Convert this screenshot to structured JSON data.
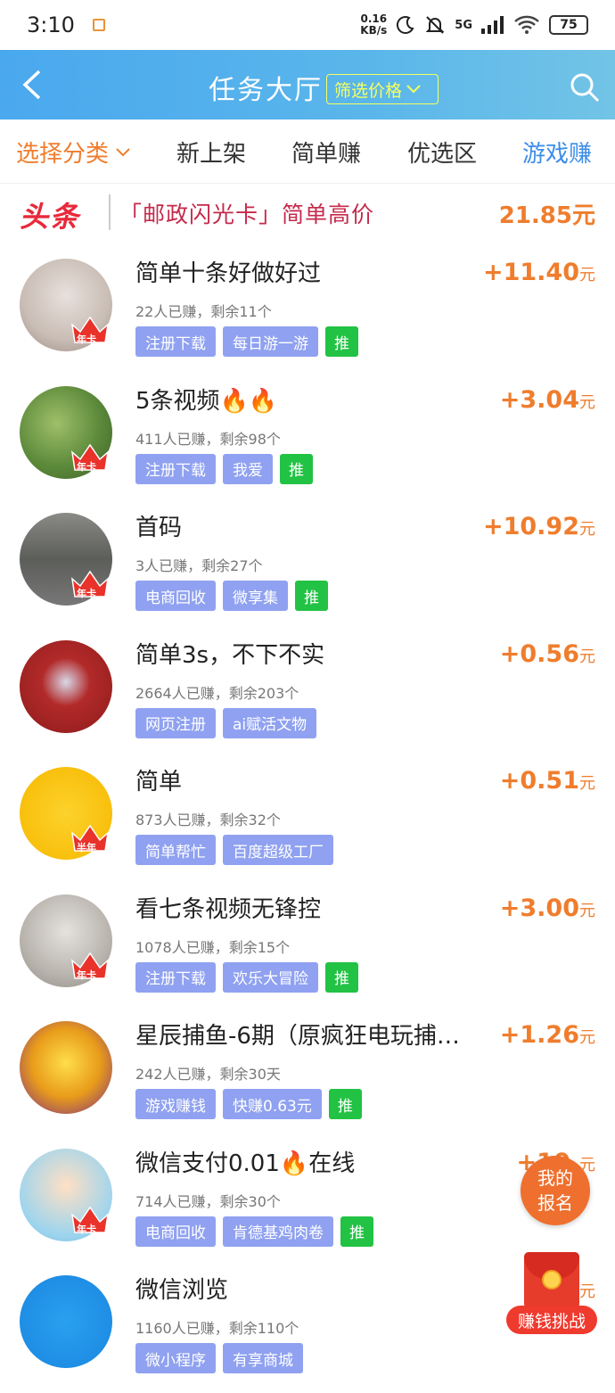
{
  "status_bar": {
    "time": "3:10",
    "speed_value": "0.16",
    "speed_unit": "KB/s",
    "network": "5G",
    "battery": "75"
  },
  "header": {
    "title": "任务大厅",
    "filter_label": "筛选价格"
  },
  "tabs": {
    "category": "选择分类",
    "new": "新上架",
    "simple": "简单赚",
    "preferred": "优选区",
    "game": "游戏赚"
  },
  "headline": {
    "source": "头条",
    "text": "「邮政闪光卡」简单高价",
    "price": "21.85元"
  },
  "items": [
    {
      "title": "简单十条好做好过",
      "stats": "22人已赚，剩余11个",
      "tags": [
        "注册下载",
        "每日游一游"
      ],
      "push": "推",
      "badge": "年卡",
      "price": "+11.40",
      "unit": "元"
    },
    {
      "title": "5条视频🔥🔥",
      "stats": "411人已赚，剩余98个",
      "tags": [
        "注册下载",
        "我爱"
      ],
      "push": "推",
      "badge": "年卡",
      "price": "+3.04",
      "unit": "元"
    },
    {
      "title": "首码",
      "stats": "3人已赚，剩余27个",
      "tags": [
        "电商回收",
        "微享集"
      ],
      "push": "推",
      "badge": "年卡",
      "price": "+10.92",
      "unit": "元"
    },
    {
      "title": "简单3s，不下不实",
      "stats": "2664人已赚，剩余203个",
      "tags": [
        "网页注册",
        "ai赋活文物"
      ],
      "push": "",
      "badge": "",
      "price": "+0.56",
      "unit": "元"
    },
    {
      "title": "简单",
      "stats": "873人已赚，剩余32个",
      "tags": [
        "简单帮忙",
        "百度超级工厂"
      ],
      "push": "",
      "badge": "半年",
      "price": "+0.51",
      "unit": "元"
    },
    {
      "title": "看七条视频无锋控",
      "stats": "1078人已赚，剩余15个",
      "tags": [
        "注册下载",
        "欢乐大冒险"
      ],
      "push": "推",
      "badge": "年卡",
      "price": "+3.00",
      "unit": "元"
    },
    {
      "title": "星辰捕鱼-6期（原疯狂电玩捕…",
      "stats": "242人已赚，剩余30天",
      "tags": [
        "游戏赚钱",
        "快赚0.63元"
      ],
      "push": "推",
      "badge": "",
      "price": "+1.26",
      "unit": "元"
    },
    {
      "title": "微信支付0.01🔥在线",
      "stats": "714人已赚，剩余30个",
      "tags": [
        "电商回收",
        "肯德基鸡肉卷"
      ],
      "push": "推",
      "badge": "年卡",
      "price": "+10.",
      "unit": "元"
    },
    {
      "title": "微信浏览",
      "stats": "1160人已赚，剩余110个",
      "tags": [
        "微小程序",
        "有享商城"
      ],
      "push": "",
      "badge": "",
      "price": "+",
      "unit": "元"
    }
  ],
  "float": {
    "my_signup": "我的报名",
    "challenge": "赚钱挑战"
  },
  "colors": {
    "accent": "#ef7d2d",
    "header_blue": "#4aa8ee",
    "tag_blue": "#8fa1f0",
    "push_green": "#22c244"
  }
}
